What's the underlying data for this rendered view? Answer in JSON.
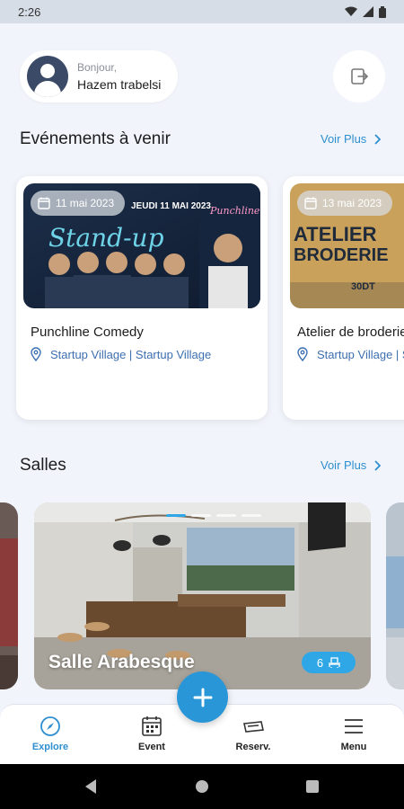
{
  "status": {
    "time": "2:26"
  },
  "user": {
    "greeting": "Bonjour,",
    "name": "Hazem trabelsi"
  },
  "events_section": {
    "title": "Evénements à venir",
    "see_more": "Voir Plus"
  },
  "events": [
    {
      "date": "11 mai 2023",
      "title": "Punchline Comedy",
      "location": "Startup Village | Startup Village",
      "poster_text": "Stand-up"
    },
    {
      "date": "13 mai 2023",
      "title": "Atelier de broderie",
      "location": "Startup Village | Startup Village",
      "poster_text": "ATELIER BRODERIE"
    }
  ],
  "rooms_section": {
    "title": "Salles",
    "see_more": "Voir Plus"
  },
  "rooms": [
    {
      "name": "Salle Arabesque",
      "capacity": "6"
    }
  ],
  "bottom_nav": [
    {
      "label": "Explore",
      "icon": "compass-icon",
      "active": true
    },
    {
      "label": "Event",
      "icon": "calendar-icon",
      "active": false
    },
    {
      "label": "Reserv.",
      "icon": "ticket-icon",
      "active": false
    },
    {
      "label": "Menu",
      "icon": "menu-icon",
      "active": false
    }
  ],
  "colors": {
    "accent": "#2e8fd0",
    "fab": "#2996d8",
    "background": "#f1f4fa",
    "capacity_badge": "#2fa7e6"
  }
}
